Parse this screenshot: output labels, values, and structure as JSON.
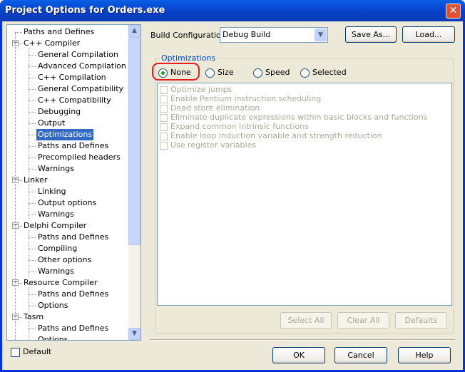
{
  "window": {
    "title": "Project Options for Orders.exe",
    "close_icon": "close-icon"
  },
  "tree": [
    {
      "label": "Paths and Defines",
      "level": 0
    },
    {
      "label": "C++ Compiler",
      "level": 0,
      "expanded": true
    },
    {
      "label": "General Compilation",
      "level": 1
    },
    {
      "label": "Advanced Compilation",
      "level": 1
    },
    {
      "label": "C++ Compilation",
      "level": 1
    },
    {
      "label": "General Compatibility",
      "level": 1
    },
    {
      "label": "C++ Compatibility",
      "level": 1
    },
    {
      "label": "Debugging",
      "level": 1
    },
    {
      "label": "Output",
      "level": 1
    },
    {
      "label": "Optimizations",
      "level": 1,
      "selected": true
    },
    {
      "label": "Paths and Defines",
      "level": 1
    },
    {
      "label": "Precompiled headers",
      "level": 1
    },
    {
      "label": "Warnings",
      "level": 1
    },
    {
      "label": "Linker",
      "level": 0,
      "expanded": true
    },
    {
      "label": "Linking",
      "level": 1
    },
    {
      "label": "Output options",
      "level": 1
    },
    {
      "label": "Warnings",
      "level": 1
    },
    {
      "label": "Delphi Compiler",
      "level": 0,
      "expanded": true
    },
    {
      "label": "Paths and Defines",
      "level": 1
    },
    {
      "label": "Compiling",
      "level": 1
    },
    {
      "label": "Other options",
      "level": 1
    },
    {
      "label": "Warnings",
      "level": 1
    },
    {
      "label": "Resource Compiler",
      "level": 0,
      "expanded": true
    },
    {
      "label": "Paths and Defines",
      "level": 1
    },
    {
      "label": "Options",
      "level": 1
    },
    {
      "label": "Tasm",
      "level": 0,
      "expanded": true
    },
    {
      "label": "Paths and Defines",
      "level": 1
    },
    {
      "label": "Options",
      "level": 1
    }
  ],
  "build": {
    "label": "Build Configuration:",
    "value": "Debug Build",
    "save_as": "Save As...",
    "load": "Load..."
  },
  "optimizations": {
    "label": "Optimizations",
    "radios": [
      "None",
      "Size",
      "Speed",
      "Selected"
    ],
    "selected": "None",
    "options": [
      "Optimize jumps",
      "Enable Pentium instruction scheduling",
      "Dead store elimination",
      "Eliminate duplicate expressions within basic blocks and functions",
      "Expand common intrinsic functions",
      "Enable loop induction variable and strength reduction",
      "Use register variables"
    ],
    "select_all": "Select All",
    "clear_all": "Clear All",
    "defaults": "Defaults"
  },
  "footer": {
    "default_label": "Default",
    "ok": "OK",
    "cancel": "Cancel",
    "help": "Help"
  }
}
